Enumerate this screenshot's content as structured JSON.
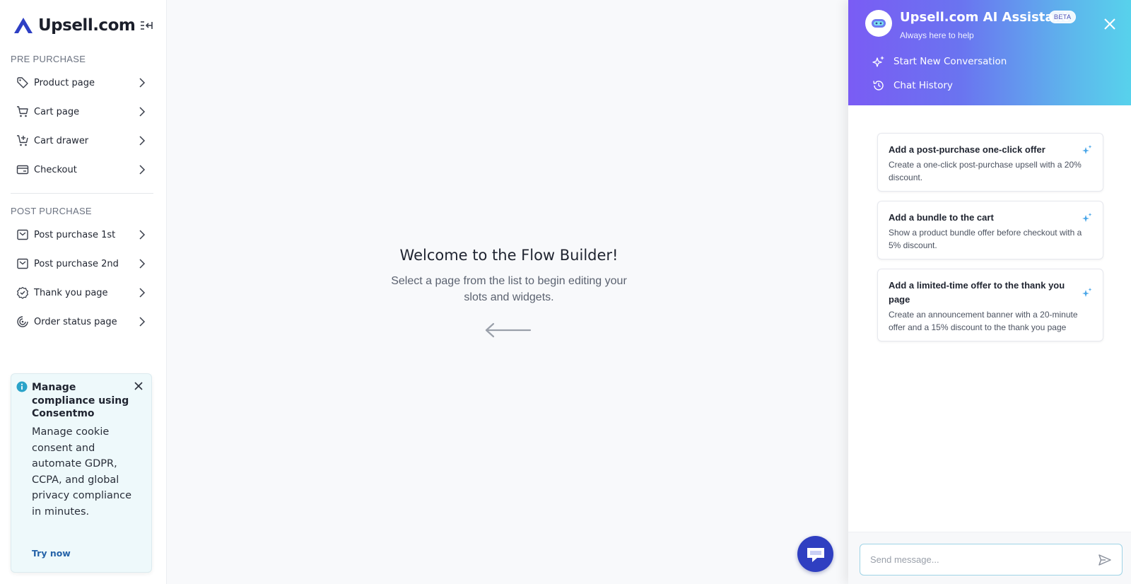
{
  "brand": {
    "name": "Upsell.com"
  },
  "sidebar": {
    "pre_title": "PRE PURCHASE",
    "post_title": "POST PURCHASE",
    "pre_items": [
      {
        "label": "Product page",
        "icon": "tag-icon"
      },
      {
        "label": "Cart page",
        "icon": "cart-icon"
      },
      {
        "label": "Cart drawer",
        "icon": "cart-add-icon"
      },
      {
        "label": "Checkout",
        "icon": "credit-card-icon"
      }
    ],
    "post_items": [
      {
        "label": "Post purchase 1st",
        "icon": "inbox-icon"
      },
      {
        "label": "Post purchase 2nd",
        "icon": "inbox-icon"
      },
      {
        "label": "Thank you page",
        "icon": "badge-check-icon"
      },
      {
        "label": "Order status page",
        "icon": "order-status-icon"
      }
    ]
  },
  "promo": {
    "title": "Manage compliance using Consentmo",
    "body": "Manage cookie consent and automate GDPR, CCPA, and global privacy compliance in minutes.",
    "cta": "Try now"
  },
  "main": {
    "title": "Welcome to the Flow Builder!",
    "subtitle": "Select a page from the list to begin editing your slots and widgets."
  },
  "assistant": {
    "title": "Upsell.com AI Assistant",
    "badge": "BETA",
    "subtitle": "Always here to help",
    "actions": [
      {
        "label": "Start New Conversation",
        "icon": "sparkle-icon"
      },
      {
        "label": "Chat History",
        "icon": "history-icon"
      }
    ],
    "suggestions": [
      {
        "title": "Add a post-purchase one-click offer",
        "desc": "Create a one-click post-purchase upsell with a 20% discount."
      },
      {
        "title": "Add a bundle to the cart",
        "desc": "Show a product bundle offer before checkout with a 5% discount."
      },
      {
        "title": "Add a limited-time offer to the thank you page",
        "desc": "Create an announcement banner with a 20-minute offer and a 15% discount to the thank you page"
      }
    ],
    "input_placeholder": "Send message..."
  },
  "colors": {
    "accent": "#2f3fc1",
    "link": "#2563a8",
    "header_start": "#7a5cf4",
    "header_end": "#57d2ec"
  }
}
